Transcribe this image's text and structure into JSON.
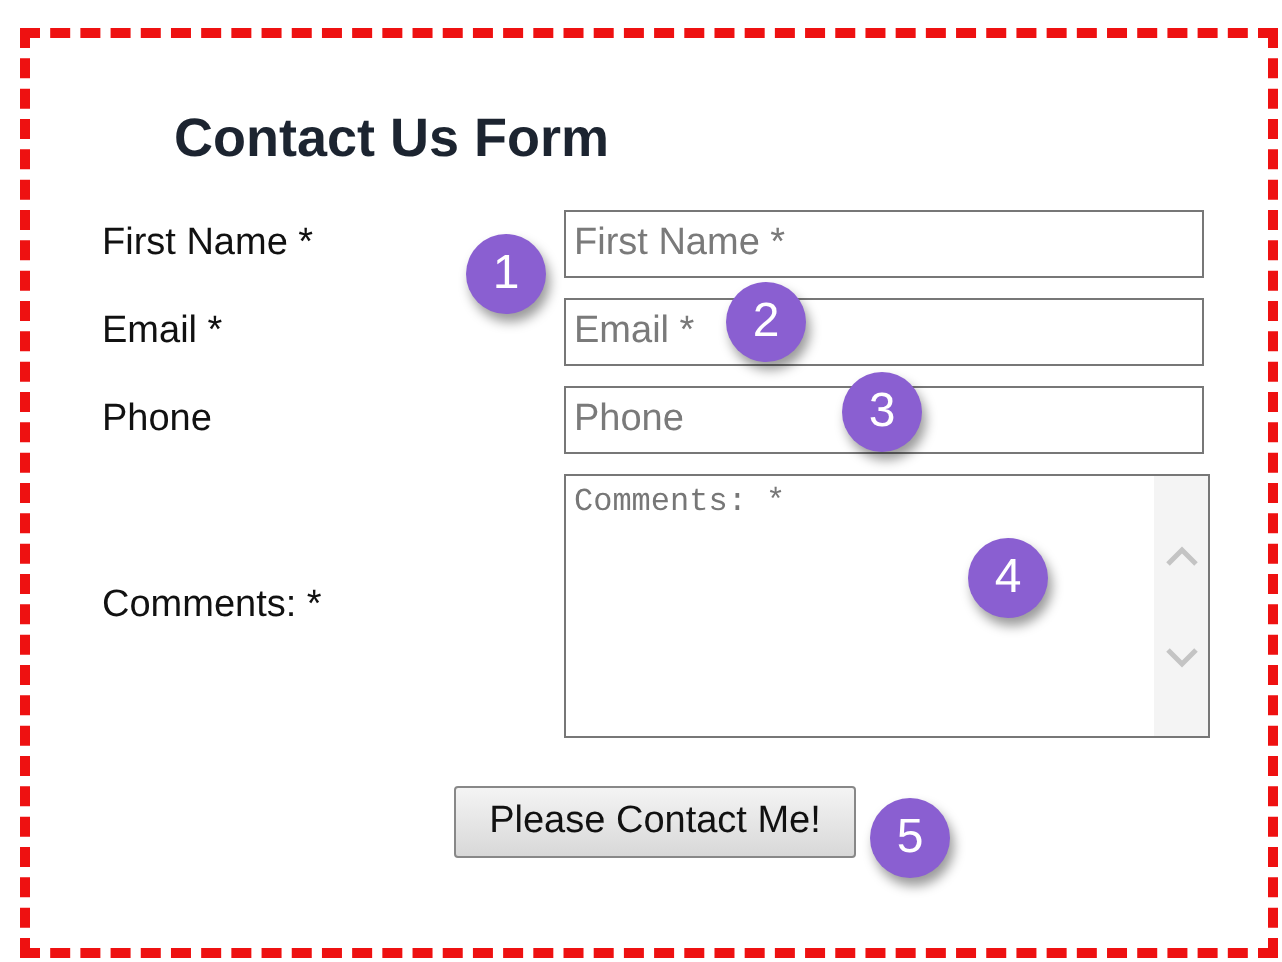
{
  "title": "Contact Us Form",
  "fields": [
    {
      "kind": "input",
      "label": "First Name *",
      "placeholder": "First Name *"
    },
    {
      "kind": "input",
      "label": "Email *",
      "placeholder": "Email *"
    },
    {
      "kind": "input",
      "label": "Phone",
      "placeholder": "Phone"
    },
    {
      "kind": "textarea",
      "label": "Comments: *",
      "placeholder": "Comments: *"
    }
  ],
  "submit": "Please Contact Me!",
  "callouts": [
    "1",
    "2",
    "3",
    "4",
    "5"
  ]
}
